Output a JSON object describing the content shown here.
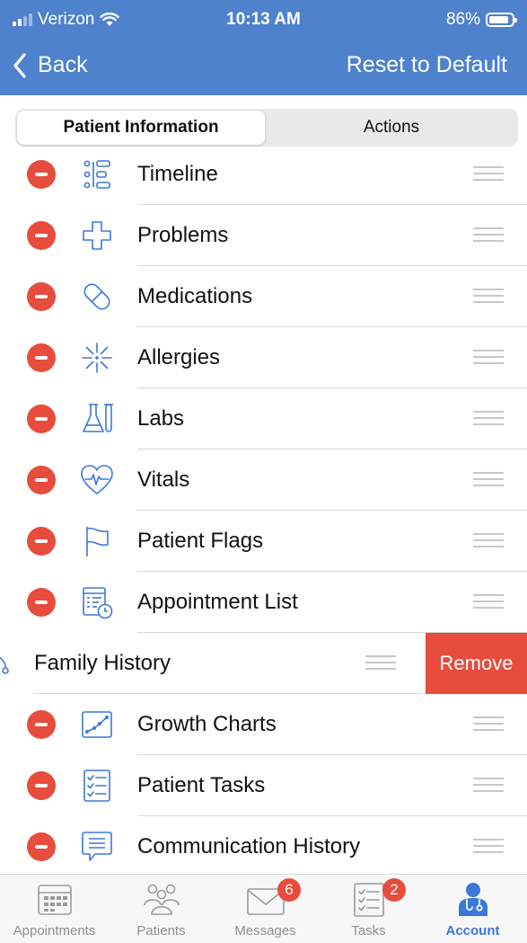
{
  "status_bar": {
    "carrier": "Verizon",
    "time": "10:13 AM",
    "battery": "86%",
    "battery_level": 0.86
  },
  "nav": {
    "back_label": "Back",
    "reset_label": "Reset to Default"
  },
  "segments": {
    "patient_information": "Patient Information",
    "actions": "Actions"
  },
  "items": [
    {
      "label": "Timeline",
      "icon": "timeline-icon"
    },
    {
      "label": "Problems",
      "icon": "cross-icon"
    },
    {
      "label": "Medications",
      "icon": "pill-icon"
    },
    {
      "label": "Allergies",
      "icon": "burst-icon"
    },
    {
      "label": "Labs",
      "icon": "flask-icon"
    },
    {
      "label": "Vitals",
      "icon": "heart-pulse-icon"
    },
    {
      "label": "Patient Flags",
      "icon": "flag-icon"
    },
    {
      "label": "Appointment List",
      "icon": "calendar-clock-icon"
    },
    {
      "label": "Family History",
      "icon": "family-tree-icon",
      "swiped": true,
      "action_label": "Remove"
    },
    {
      "label": "Growth Charts",
      "icon": "growth-chart-icon"
    },
    {
      "label": "Patient Tasks",
      "icon": "checklist-icon"
    },
    {
      "label": "Communication History",
      "icon": "chat-bubble-icon"
    }
  ],
  "tabs": [
    {
      "label": "Appointments",
      "icon": "calendar-icon"
    },
    {
      "label": "Patients",
      "icon": "people-icon"
    },
    {
      "label": "Messages",
      "icon": "envelope-icon",
      "badge": "6"
    },
    {
      "label": "Tasks",
      "icon": "task-list-icon",
      "badge": "2"
    },
    {
      "label": "Account",
      "icon": "doctor-icon",
      "active": true
    }
  ],
  "colors": {
    "header": "#4f82cc",
    "accent": "#3b78d8",
    "destructive": "#e74c3c",
    "tab_inactive": "#8e8e93"
  }
}
